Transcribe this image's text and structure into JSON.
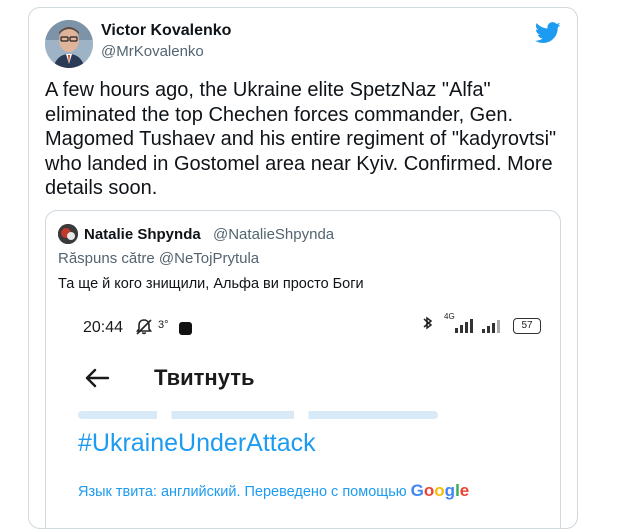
{
  "tweet": {
    "author_name": "Victor Kovalenko",
    "author_handle": "@MrKovalenko",
    "text": "A few hours ago, the Ukraine elite SpetzNaz \"Alfa\" eliminated the top Chechen forces commander, Gen. Magomed Tushaev and his entire regiment of \"kadyrovtsi\" who landed in Gostomel area near Kyiv. Confirmed. More details soon.",
    "brand_icon": "twitter-bird-icon",
    "brand_color": "#1d9bf0"
  },
  "quote": {
    "author_name": "Natalie Shpynda",
    "author_handle": "@NatalieShpynda",
    "reply_prefix": "Răspuns către",
    "reply_mention": "@NeTojPrytula",
    "text": "Та ще й кого знищили, Альфа ви просто Боги"
  },
  "screenshot": {
    "status_time": "20:44",
    "status_extra": "3°",
    "network_label": "4G",
    "battery": "57",
    "screen_title": "Твитнуть",
    "hashtag": "#UkraineUnderAttack",
    "translation_text": "Язык твита: английский. Переведено с помощью",
    "translation_brand": "Google",
    "hashtag_color": "#1d9bf0"
  }
}
